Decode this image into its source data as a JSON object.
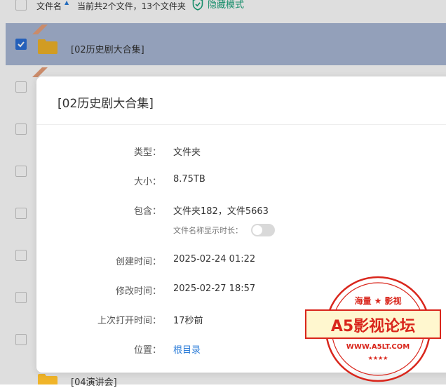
{
  "header": {
    "name_label": "文件名",
    "count_text": "当前共2个文件，13个文件夹",
    "hidden_mode_label": "隐藏模式"
  },
  "rows": [
    {
      "name": "[02历史剧大合集]",
      "selected": true,
      "badge": "置顶"
    },
    {
      "name": "",
      "selected": false,
      "badge": "置顶"
    }
  ],
  "bottom_row": {
    "name": "[04演讲会]"
  },
  "modal": {
    "title": "[02历史剧大合集]",
    "fields": [
      {
        "label": "类型：",
        "value": "文件夹"
      },
      {
        "label": "大小：",
        "value": "8.75TB"
      },
      {
        "label": "包含：",
        "value": "文件夹182，文件5663"
      },
      {
        "label": "创建时间：",
        "value": "2025-02-24 01:22"
      },
      {
        "label": "修改时间：",
        "value": "2025-02-27 18:57"
      },
      {
        "label": "上次打开时间：",
        "value": "17秒前"
      },
      {
        "label": "位置：",
        "value": "根目录"
      }
    ],
    "show_name_length_label": "文件名称显示时长：",
    "show_name_length_on": false
  },
  "watermark": {
    "top_text": "海量 ★ 影视",
    "main_text": "A5影视论坛",
    "url_text": "WWW.A5LT.COM",
    "stars_text": "★★★★",
    "color": "#d9261c"
  },
  "colors": {
    "selected_row": "#a9b8d6",
    "checkbox_checked": "#2b6fd6",
    "hidden_mode": "#1aa37a",
    "link": "#2b7cd8",
    "folder": "#f0b429"
  }
}
